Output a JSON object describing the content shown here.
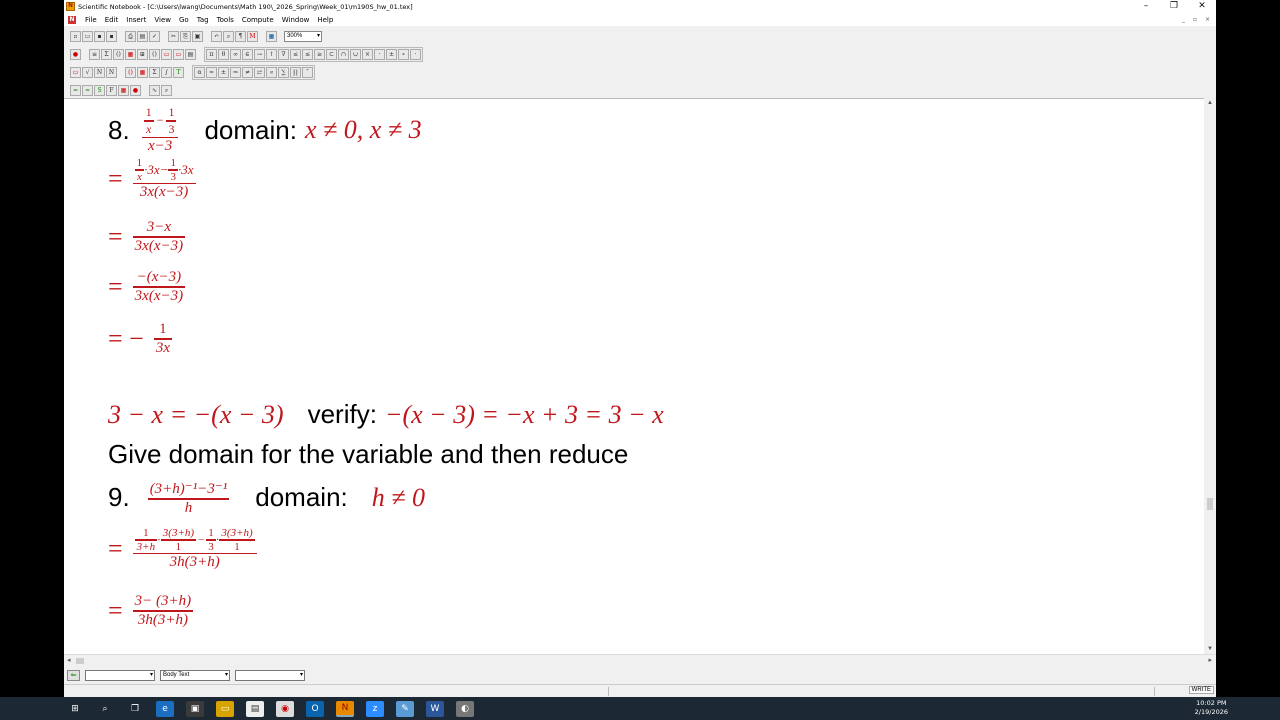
{
  "window": {
    "title": "Scientific Notebook - [C:\\Users\\lwang\\Documents\\Math 190\\_2026_Spring\\Week_01\\m190S_hw_01.tex]",
    "minimize": "–",
    "restore": "❐",
    "close": "✕"
  },
  "menu": [
    "File",
    "Edit",
    "Insert",
    "View",
    "Go",
    "Tag",
    "Tools",
    "Compute",
    "Window",
    "Help"
  ],
  "toolbar": {
    "zoom": "300%",
    "row2_symbols": [
      "π",
      "θ",
      "∞",
      "∈",
      "→",
      "↑",
      "∇",
      "≤",
      "≤",
      "≥",
      "⊂",
      "∩",
      "∪",
      "×",
      "·",
      "±",
      "∘",
      "·"
    ]
  },
  "problem8": {
    "number": "8.",
    "domain_label": "domain:",
    "domain_expr": "x ≠ 0, x ≠ 3",
    "given": {
      "num_a": "1",
      "num_a_den": "x",
      "minus": "−",
      "num_b": "1",
      "num_b_den": "3",
      "den": "x−3"
    },
    "step1": {
      "eq": "=",
      "num": "·3x− ",
      "num2": "·3x",
      "den": "3x(x−3)"
    },
    "step2": {
      "eq": "=",
      "num": "3−x",
      "den": "3x(x−3)"
    },
    "step3": {
      "eq": "=",
      "num": "−(x−3)",
      "den": "3x(x−3)"
    },
    "step4": {
      "eq": "= −",
      "num": "1",
      "den": "3x"
    }
  },
  "verify_line": {
    "lhs": "3 − x = −(x − 3)",
    "label": "verify:",
    "rhs": "−(x − 3) = −x + 3 = 3 − x"
  },
  "instruction": "Give domain for the variable and then reduce",
  "problem9": {
    "number": "9.",
    "domain_label": "domain:",
    "domain_expr": "h ≠ 0",
    "given": {
      "num": "(3+h)⁻¹−3⁻¹",
      "den": "h"
    },
    "step1": {
      "eq": "=",
      "den": "3h(3+h)"
    },
    "step2": {
      "eq": "=",
      "num": "3− (3+h)",
      "den": "3h(3+h)"
    }
  },
  "tagbar": {
    "body_tag": "Body Text"
  },
  "status": {
    "mode": "WRITE"
  },
  "clock": {
    "time": "10:02 PM",
    "date": "2/19/2026"
  }
}
